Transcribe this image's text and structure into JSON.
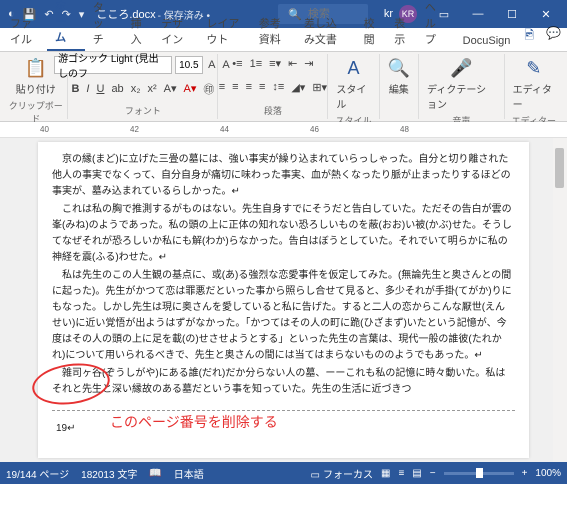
{
  "title": {
    "filename": "こころ.docx",
    "saved": "- 保存済み •",
    "search_placeholder": "検索",
    "user_initials": "kr",
    "avatar": "KR"
  },
  "tabs": {
    "items": [
      "ファイル",
      "ホーム",
      "タッチ",
      "挿入",
      "デザイン",
      "レイアウト",
      "参考資料",
      "差し込み文書",
      "校閲",
      "表示",
      "ヘルプ",
      "DocuSign"
    ],
    "active": 1
  },
  "ribbon": {
    "clipboard": {
      "paste": "貼り付け",
      "label": "クリップボード"
    },
    "font": {
      "name": "游ゴシック Light (見出しのフ",
      "size": "10.5",
      "label": "フォント"
    },
    "paragraph": {
      "label": "段落"
    },
    "styles": {
      "btn": "スタイル",
      "label": "スタイル"
    },
    "editing": {
      "btn": "編集"
    },
    "dictation": {
      "btn": "ディクテーション",
      "label": "音声"
    },
    "editor": {
      "btn": "エディター",
      "label": "エディター"
    }
  },
  "ruler": {
    "marks": [
      "40",
      "42",
      "44",
      "46",
      "48"
    ]
  },
  "document": {
    "paragraphs": [
      "京の縁(まど)に立げた三畳の墓には、強い事実が繰り込まれていらっしゃった。自分と切り離された他人の事実でなくって、自分自身が痛切に味わった事実、血が熱くなったり脈が止まったりするほどの事実が、墓み込まれているらしかった。↵",
      "これは私の胸で推測するがものはない。先生自身すでにそうだと告白していた。ただその告白が雲の峯(みね)のようであった。私の頭の上に正体の知れない恐ろしいものを蔽(おお)い被(かぶ)せた。そうしてなぜそれが恐ろしいか私にも解(わか)らなかった。告白はぼうとしていた。それでいて明らかに私の神経を震(ふる)わせた。↵",
      "私は先生のこの人生観の基点に、或(あ)る強烈な恋愛事件を仮定してみた。(無論先生と奥さんとの間に起った)。先生がかつて恋は罪悪だといった事から照らし合せて見ると、多少それが手掛(てがか)りにもなった。しかし先生は現に奥さんを愛していると私に告げた。すると二人の恋からこんな厭世(えんせい)に近い覚悟が出ようはずがなかった。「かつてはその人の町に跪(ひざまず)いたという記憶が、今度はその人の頭の上に足を載(の)せさせようとする」といった先生の言葉は、現代一般の誰彼(たれかれ)について用いられるべきで、先生と奥さんの間には当てはまらないもののようでもあった。↵",
      "雑司ヶ谷(ぞうしがや)にある誰(だれ)だか分らない人の墓、ーーこれも私の記憶に時々動いた。私はそれと先生と深い縁故のある墓だという事を知っていた。先生の生活に近づきつ"
    ],
    "page_number": "19↵",
    "annotation": "このページ番号を削除する"
  },
  "status": {
    "pages": "19/144 ページ",
    "words": "182013 文字",
    "lang": "日本語",
    "focus": "フォーカス",
    "zoom": "100%"
  }
}
